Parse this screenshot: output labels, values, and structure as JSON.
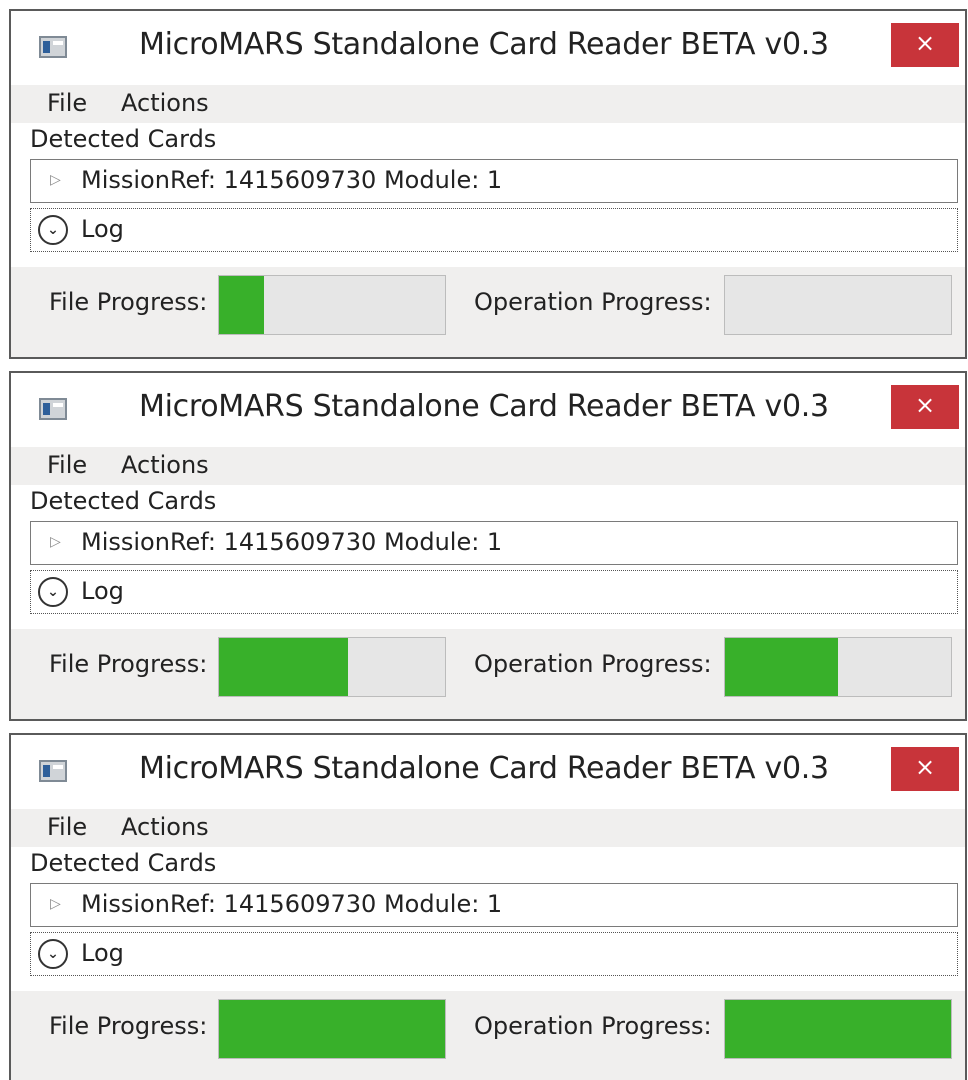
{
  "windows": [
    {
      "title": "MicroMARS Standalone Card Reader BETA v0.3",
      "close_glyph": "×",
      "menu": [
        "File",
        "Actions"
      ],
      "detected_cards_label": "Detected Cards",
      "card": "MissionRef: 1415609730 Module: 1",
      "log_label": "Log",
      "file_progress_label": "File Progress:",
      "operation_progress_label": "Operation Progress:",
      "file_progress_value": 0.2,
      "operation_progress_value": 0.0
    },
    {
      "title": "MicroMARS Standalone Card Reader BETA v0.3",
      "close_glyph": "×",
      "menu": [
        "File",
        "Actions"
      ],
      "detected_cards_label": "Detected Cards",
      "card": "MissionRef: 1415609730 Module: 1",
      "log_label": "Log",
      "file_progress_label": "File Progress:",
      "operation_progress_label": "Operation Progress:",
      "file_progress_value": 0.57,
      "operation_progress_value": 0.5
    },
    {
      "title": "MicroMARS Standalone Card Reader BETA v0.3",
      "close_glyph": "×",
      "menu": [
        "File",
        "Actions"
      ],
      "detected_cards_label": "Detected Cards",
      "card": "MissionRef: 1415609730 Module: 1",
      "log_label": "Log",
      "file_progress_label": "File Progress:",
      "operation_progress_label": "Operation Progress:",
      "file_progress_value": 1.0,
      "operation_progress_value": 1.0
    }
  ],
  "icons": {
    "app": "app-window-icon",
    "close": "close-icon",
    "tree_expander": "triangle-right-icon",
    "log_expander": "chevron-down-circle-icon"
  },
  "colors": {
    "progress_fill": "#38b02a",
    "progress_track": "#e6e6e6",
    "close_button": "#c8343a"
  }
}
